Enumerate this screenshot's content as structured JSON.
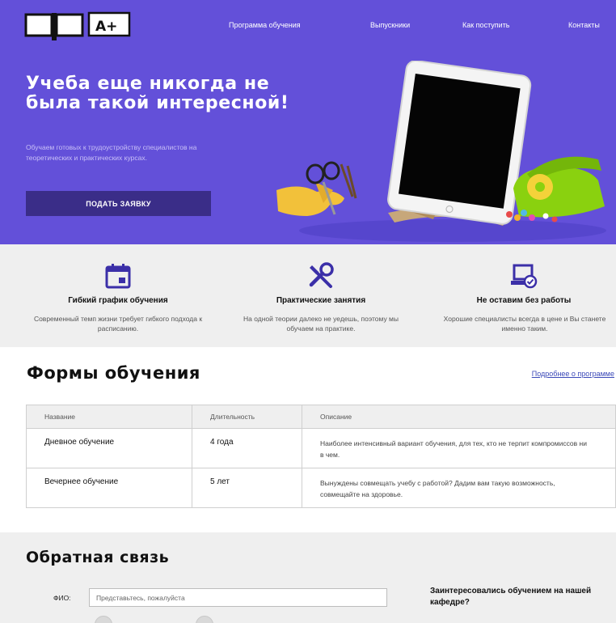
{
  "header": {
    "logo_text": "A+",
    "nav": [
      {
        "label": "Программа обучения"
      },
      {
        "label": "Выпускники"
      },
      {
        "label": "Как поступить"
      },
      {
        "label": "Контакты"
      }
    ]
  },
  "hero": {
    "title": "Учеба еще никогда не была такой интересной!",
    "subtitle": "Обучаем готовых к трудоустройству специалистов на теоретических и практических курсах.",
    "cta_label": "ПОДАТЬ ЗАЯВКУ"
  },
  "features": [
    {
      "icon": "calendar-icon",
      "title": "Гибкий график обучения",
      "text": "Современный темп жизни требует гибкого подхода к расписанию."
    },
    {
      "icon": "tools-icon",
      "title": "Практические занятия",
      "text": "На одной теории далеко не уедешь, поэтому мы обучаем на практике."
    },
    {
      "icon": "laptop-check-icon",
      "title": "Не оставим без работы",
      "text": "Хорошие специалисты всегда в цене и Вы станете именно таким."
    }
  ],
  "study_forms": {
    "title": "Формы обучения",
    "link_label": "Подробнее о программе",
    "columns": [
      "Название",
      "Длительность",
      "Описание"
    ],
    "rows": [
      {
        "name": "Дневное обучение",
        "duration": "4 года",
        "description": "Наиболее интенсивный вариант обучения, для тех, кто не терпит компромиссов ни в чем."
      },
      {
        "name": "Вечернее обучение",
        "duration": "5 лет",
        "description": "Вынуждены совмещать учебу с работой? Дадим вам такую возможность, совмещайте на здоровье."
      }
    ]
  },
  "feedback": {
    "title": "Обратная связь",
    "name_label": "ФИО:",
    "name_placeholder": "Представьтесь, пожалуйста",
    "aside": "Заинтересовались обучением на нашей кафедре?"
  },
  "colors": {
    "hero_bg": "#6350d9",
    "cta_bg": "#3a2d88",
    "icon_color": "#3b2fa8",
    "section_gray": "#efefef",
    "link": "#3b49b8"
  }
}
